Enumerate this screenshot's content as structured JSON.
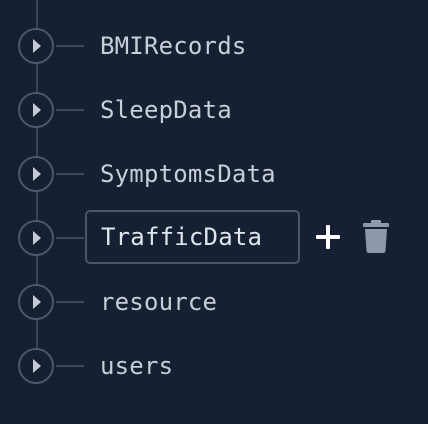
{
  "tree": {
    "items": [
      {
        "label": "BMIRecords",
        "expander_icon": "chevron-right-icon"
      },
      {
        "label": "SleepData",
        "expander_icon": "chevron-right-icon"
      },
      {
        "label": "SymptomsData",
        "expander_icon": "chevron-right-icon"
      },
      {
        "label": "TrafficData",
        "expander_icon": "chevron-right-icon",
        "selected": true
      },
      {
        "label": "resource",
        "expander_icon": "chevron-right-icon"
      },
      {
        "label": "users",
        "expander_icon": "chevron-right-icon"
      }
    ]
  },
  "actions": {
    "add_icon": "plus-icon",
    "delete_icon": "trash-icon"
  },
  "colors": {
    "background": "#152033",
    "text": "#c8ced8",
    "selected_text": "#e1e6ec",
    "border": "#4a5567",
    "tree_line": "#3b4658",
    "delete_icon": "#8e99ab"
  }
}
